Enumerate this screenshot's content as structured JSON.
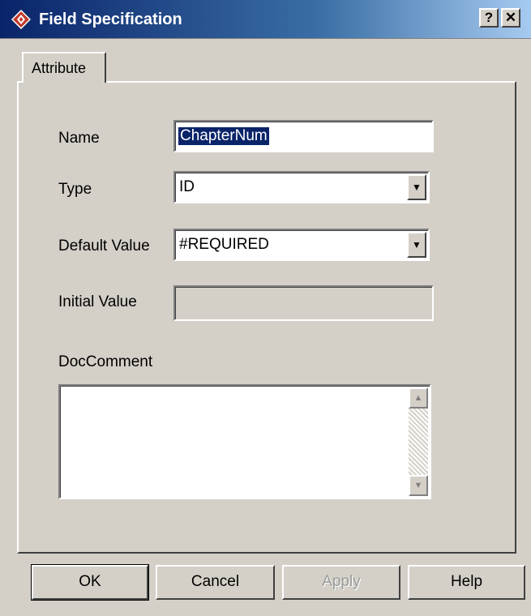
{
  "window": {
    "title": "Field Specification",
    "help_button": "?",
    "close_button": "✕"
  },
  "tabs": [
    {
      "label": "Attribute"
    }
  ],
  "form": {
    "name": {
      "label": "Name",
      "value": "ChapterNum"
    },
    "type": {
      "label": "Type",
      "value": "ID"
    },
    "default_value": {
      "label": "Default Value",
      "value": "#REQUIRED"
    },
    "initial_value": {
      "label": "Initial Value",
      "value": ""
    },
    "doc_comment": {
      "label": "DocComment",
      "value": ""
    }
  },
  "buttons": {
    "ok": "OK",
    "cancel": "Cancel",
    "apply": "Apply",
    "help": "Help"
  },
  "icons": {
    "app": "red-diamond-app-icon",
    "dropdown": "chevron-down-icon",
    "scroll_up": "arrow-up-icon",
    "scroll_down": "arrow-down-icon"
  },
  "colors": {
    "titlebar_start": "#0a246a",
    "titlebar_end": "#a6caf0",
    "window_bg": "#d4d0c8",
    "selection": "#0a246a"
  }
}
